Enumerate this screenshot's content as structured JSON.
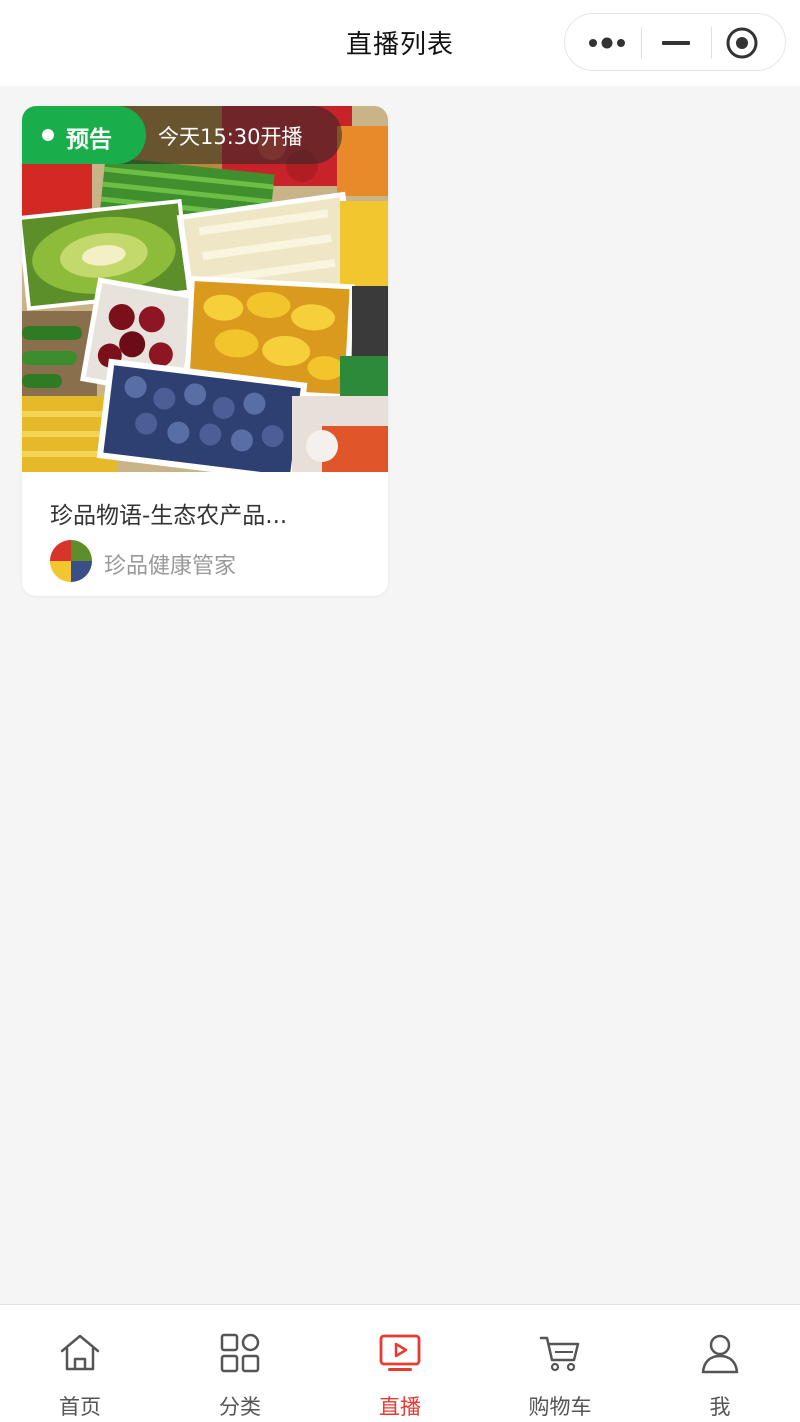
{
  "nav": {
    "title": "直播列表"
  },
  "capsule": {
    "more_icon": "more-dots-icon",
    "minimize_icon": "minus-icon",
    "close_icon": "target-icon"
  },
  "live_card": {
    "badge_label": "预告",
    "start_time": "今天15:30开播",
    "title": "珍品物语-生态农产品...",
    "anchor_name": "珍品健康管家",
    "badge_color": "#1aad4b"
  },
  "tabbar": {
    "active_color": "#e83a30",
    "items": [
      {
        "label": "首页",
        "icon": "home-icon"
      },
      {
        "label": "分类",
        "icon": "category-icon"
      },
      {
        "label": "直播",
        "icon": "live-tv-icon"
      },
      {
        "label": "购物车",
        "icon": "cart-icon"
      },
      {
        "label": "我",
        "icon": "user-icon"
      }
    ]
  }
}
